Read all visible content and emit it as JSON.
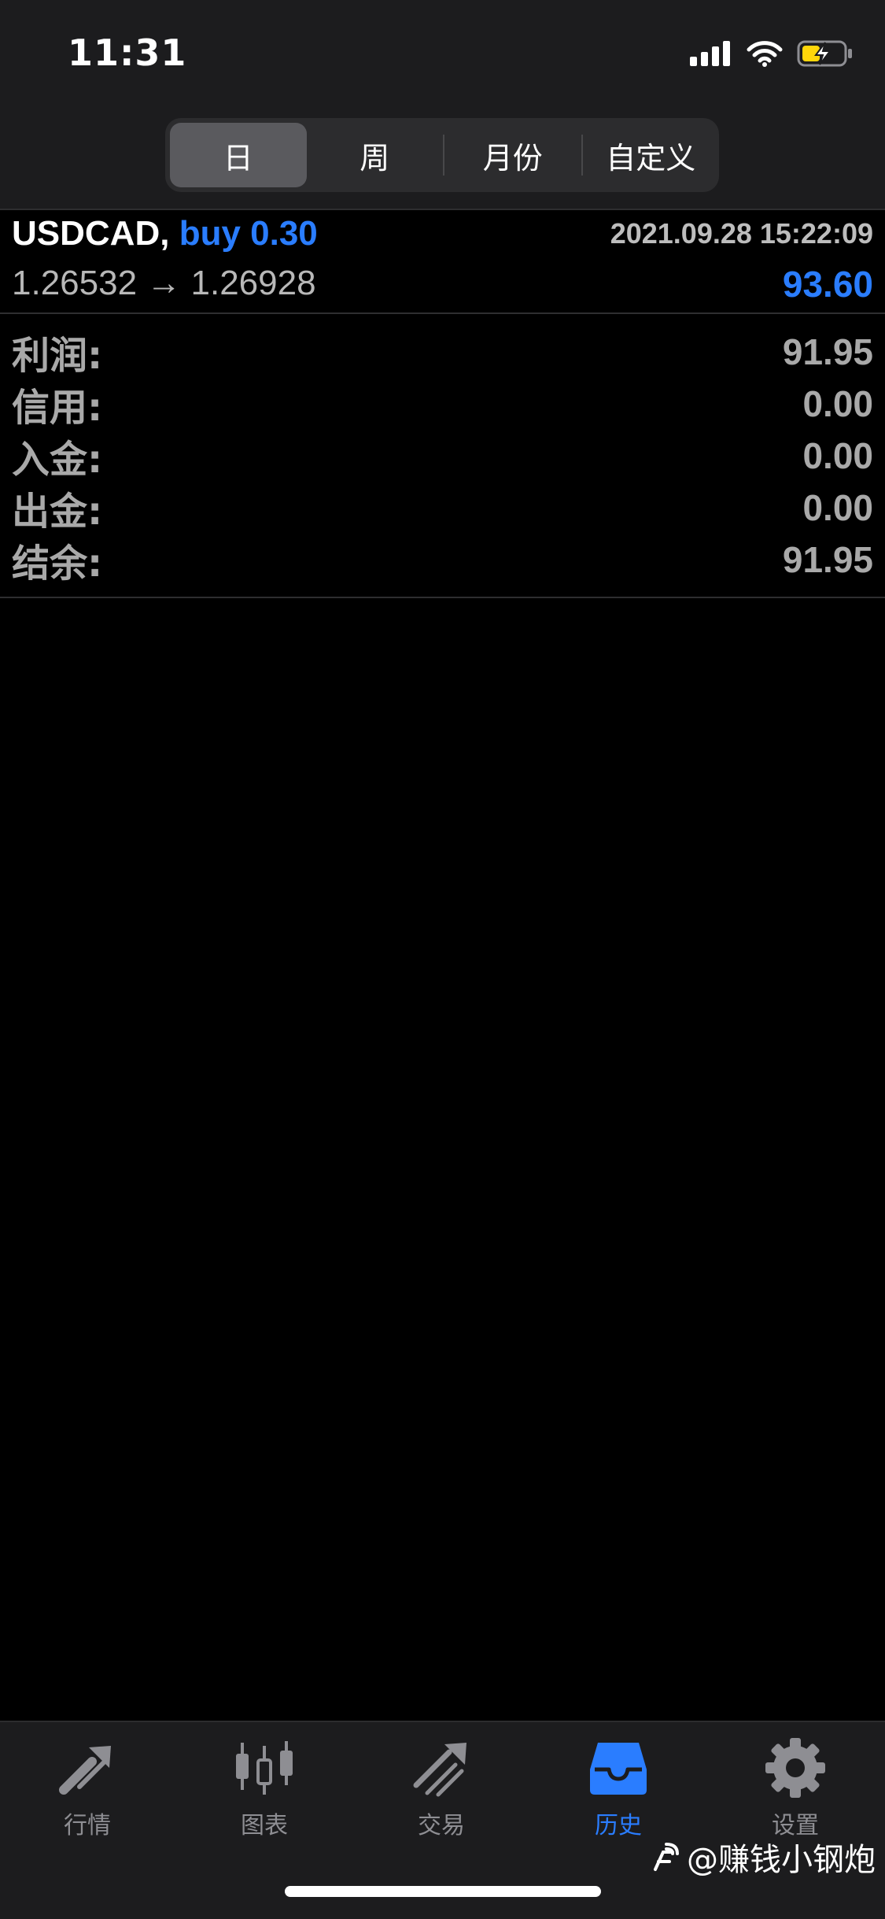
{
  "status_bar": {
    "time": "11:31"
  },
  "segments": {
    "items": [
      "日",
      "周",
      "月份",
      "自定义"
    ],
    "active": "日"
  },
  "deal": {
    "symbol": "USDCAD,",
    "side_volume": "buy 0.30",
    "time": "2021.09.28 15:22:09",
    "prices": "1.26532 → 1.26928",
    "profit": "93.60"
  },
  "summary": [
    {
      "label": "利润:",
      "value": "91.95"
    },
    {
      "label": "信用:",
      "value": "0.00"
    },
    {
      "label": "入金:",
      "value": "0.00"
    },
    {
      "label": "出金:",
      "value": "0.00"
    },
    {
      "label": "结余:",
      "value": "91.95"
    }
  ],
  "tabs": [
    {
      "label": "行情",
      "icon": "quotes-icon"
    },
    {
      "label": "图表",
      "icon": "chart-candles-icon"
    },
    {
      "label": "交易",
      "icon": "trade-icon"
    },
    {
      "label": "历史",
      "icon": "history-icon",
      "active": true
    },
    {
      "label": "设置",
      "icon": "gear-icon"
    }
  ],
  "watermark": {
    "text": "@赚钱小钢炮"
  },
  "colors": {
    "accent": "#2a7dff",
    "background": "#000000",
    "bar": "#1c1c1e"
  }
}
